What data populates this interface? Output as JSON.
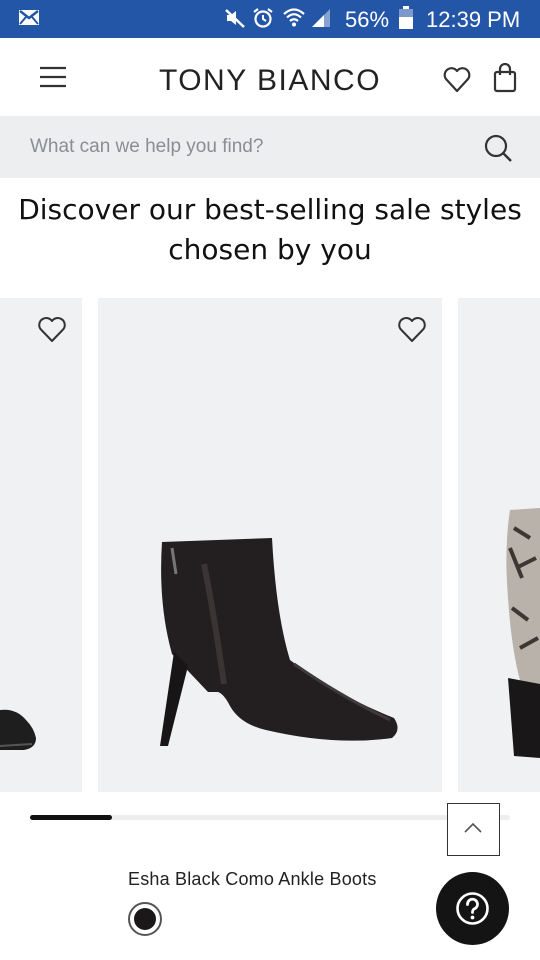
{
  "status_bar": {
    "battery_percent": "56%",
    "time": "12:39 PM",
    "icons": [
      "mail-icon",
      "mute-icon",
      "alarm-icon",
      "wifi-icon",
      "signal-icon",
      "battery-icon"
    ],
    "background": "#2456a8"
  },
  "header": {
    "logo": "TONY BIANCO",
    "icons": [
      "menu-icon",
      "heart-icon",
      "shopping-bag-icon"
    ]
  },
  "search": {
    "placeholder": "What can we help you find?",
    "icon": "search-icon"
  },
  "headline": {
    "line1": "Discover our best-selling sale styles",
    "line2": "chosen by you"
  },
  "carousel": {
    "card_background": "#eff1f3",
    "progress_fraction": 0.17,
    "featured_product": {
      "name": "Esha Black Como Ankle Boots",
      "swatch_color": "#1b1819"
    }
  },
  "controls": {
    "scroll_top_icon": "chevron-up-icon",
    "help_icon": "question-icon"
  }
}
